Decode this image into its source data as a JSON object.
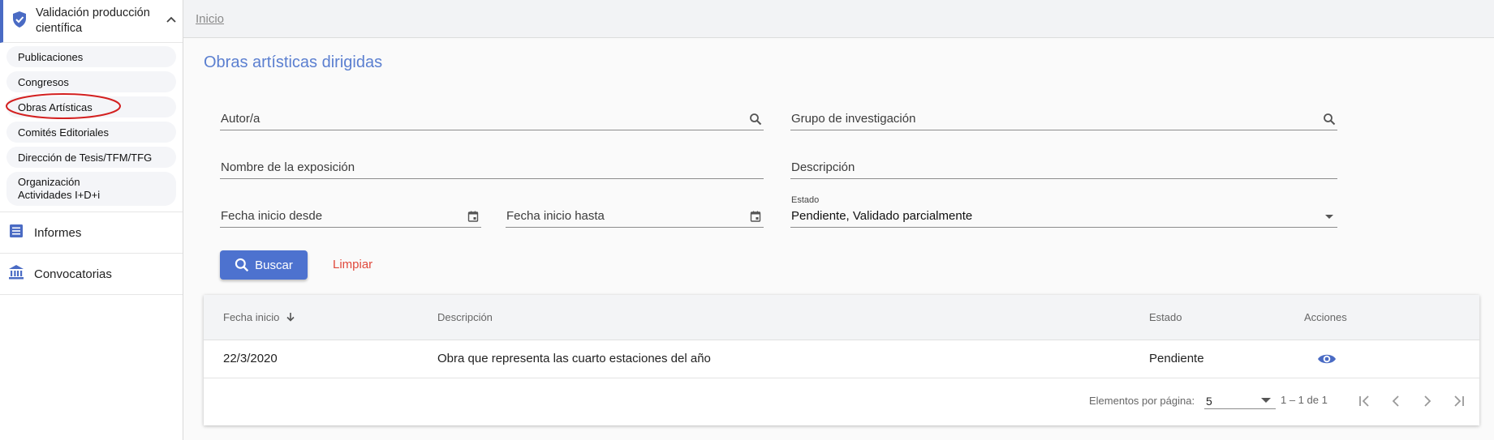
{
  "sidebar": {
    "section_title": "Validación producción científica",
    "sub_items": [
      {
        "label": "Publicaciones"
      },
      {
        "label": "Congresos"
      },
      {
        "label": "Obras Artísticas"
      },
      {
        "label": "Comités Editoriales"
      },
      {
        "label": "Dirección de Tesis/TFM/TFG"
      },
      {
        "label": "Organización Actividades I+D+i"
      }
    ],
    "main_items": [
      {
        "label": "Informes",
        "icon": "list-icon"
      },
      {
        "label": "Convocatorias",
        "icon": "bank-icon"
      }
    ]
  },
  "breadcrumb": {
    "home": "Inicio"
  },
  "page": {
    "title": "Obras artísticas dirigidas"
  },
  "filters": {
    "autor_placeholder": "Autor/a",
    "grupo_placeholder": "Grupo de investigación",
    "nombre_exposicion_placeholder": "Nombre de la exposición",
    "descripcion_placeholder": "Descripción",
    "fecha_desde_placeholder": "Fecha inicio desde",
    "fecha_hasta_placeholder": "Fecha inicio hasta",
    "estado_label": "Estado",
    "estado_value": "Pendiente, Validado parcialmente"
  },
  "actions": {
    "search_label": "Buscar",
    "clear_label": "Limpiar"
  },
  "table": {
    "headers": {
      "fecha": "Fecha inicio",
      "descripcion": "Descripción",
      "estado": "Estado",
      "acciones": "Acciones"
    },
    "rows": [
      {
        "fecha": "22/3/2020",
        "descripcion": "Obra que representa las cuarto estaciones del año",
        "estado": "Pendiente"
      }
    ]
  },
  "paginator": {
    "items_per_page_label": "Elementos por página:",
    "page_size": "5",
    "range": "1 – 1 de 1"
  },
  "colors": {
    "accent": "#4d72cf",
    "title": "#5b7fd0",
    "clear": "#e0493c"
  }
}
